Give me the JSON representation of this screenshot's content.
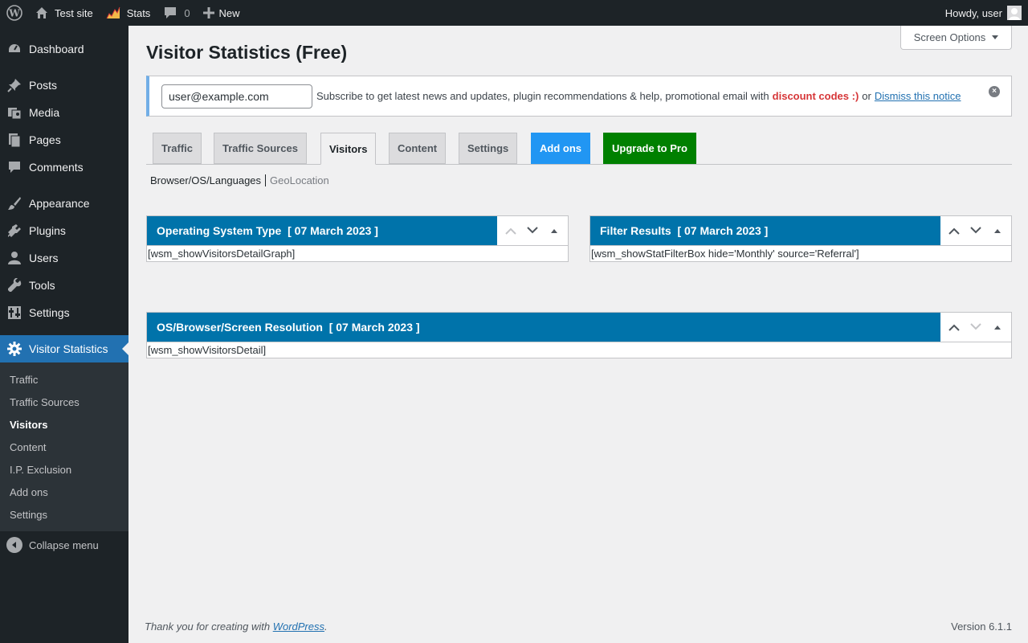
{
  "adminbar": {
    "site_name": "Test site",
    "stats_label": "Stats",
    "comments_count": "0",
    "new_label": "New",
    "howdy": "Howdy, user"
  },
  "sidebar": {
    "items": [
      {
        "label": "Dashboard",
        "icon": "dashboard-icon"
      },
      {
        "label": "Posts",
        "icon": "pin-icon"
      },
      {
        "label": "Media",
        "icon": "media-icon"
      },
      {
        "label": "Pages",
        "icon": "pages-icon"
      },
      {
        "label": "Comments",
        "icon": "comment-icon"
      },
      {
        "label": "Appearance",
        "icon": "brush-icon"
      },
      {
        "label": "Plugins",
        "icon": "plug-icon"
      },
      {
        "label": "Users",
        "icon": "user-icon"
      },
      {
        "label": "Tools",
        "icon": "wrench-icon"
      },
      {
        "label": "Settings",
        "icon": "settings-icon"
      },
      {
        "label": "Visitor Statistics",
        "icon": "gear-icon"
      }
    ],
    "submenu": [
      "Traffic",
      "Traffic Sources",
      "Visitors",
      "Content",
      "I.P. Exclusion",
      "Add ons",
      "Settings"
    ],
    "collapse_label": "Collapse menu"
  },
  "screen_options": "Screen Options",
  "page_title": "Visitor Statistics (Free)",
  "notice": {
    "email_value": "user@example.com",
    "text": "Subscribe to get latest news and updates, plugin recommendations & help, promotional email with",
    "highlight": "discount codes :)",
    "or": "or",
    "dismiss_link": "Dismiss this notice"
  },
  "tabs": [
    "Traffic",
    "Traffic Sources",
    "Visitors",
    "Content",
    "Settings",
    "Add ons",
    "Upgrade to Pro"
  ],
  "subnav": {
    "current": "Browser/OS/Languages",
    "other": "GeoLocation"
  },
  "panels": {
    "os_type": {
      "title": "Operating System Type  [ 07 March 2023 ]",
      "body": "[wsm_showVisitorsDetailGraph]"
    },
    "filter": {
      "title": "Filter Results  [ 07 March 2023 ]",
      "body": "[wsm_showStatFilterBox hide='Monthly' source='Referral']"
    },
    "resolution": {
      "title": "OS/Browser/Screen Resolution  [ 07 March 2023 ]",
      "body": "[wsm_showVisitorsDetail]"
    }
  },
  "footer": {
    "thanks_prefix": "Thank you for creating with",
    "wp_link": "WordPress",
    "suffix": ".",
    "version": "Version 6.1.1"
  },
  "colors": {
    "panel_header": "#0073aa",
    "current_menu": "#2271b1",
    "addons_tab": "#2196f3",
    "upgrade_tab": "#008000"
  }
}
